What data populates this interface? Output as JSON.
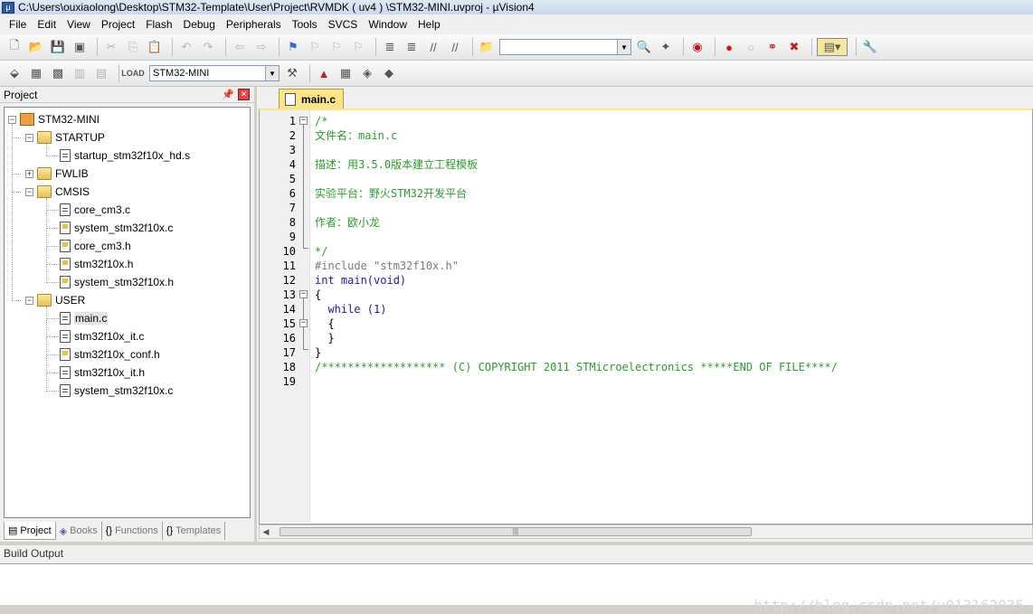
{
  "window": {
    "title": "C:\\Users\\ouxiaolong\\Desktop\\STM32-Template\\User\\Project\\RVMDK ( uv4 ) \\STM32-MINI.uvproj - µVision4"
  },
  "menu": [
    "File",
    "Edit",
    "View",
    "Project",
    "Flash",
    "Debug",
    "Peripherals",
    "Tools",
    "SVCS",
    "Window",
    "Help"
  ],
  "toolbar": {
    "search_combo_value": "",
    "target_combo_value": "STM32-MINI"
  },
  "project_panel": {
    "title": "Project",
    "tree": {
      "root": "STM32-MINI",
      "groups": [
        {
          "name": "STARTUP",
          "files": [
            "startup_stm32f10x_hd.s"
          ]
        },
        {
          "name": "FWLIB",
          "files": []
        },
        {
          "name": "CMSIS",
          "files": [
            "core_cm3.c",
            "system_stm32f10x.c",
            "core_cm3.h",
            "stm32f10x.h",
            "system_stm32f10x.h"
          ]
        },
        {
          "name": "USER",
          "files": [
            "main.c",
            "stm32f10x_it.c",
            "stm32f10x_conf.h",
            "stm32f10x_it.h",
            "system_stm32f10x.c"
          ]
        }
      ]
    },
    "tabs": [
      "Project",
      "Books",
      "Functions",
      "Templates"
    ]
  },
  "editor": {
    "tab_label": "main.c",
    "lines": [
      {
        "n": "1",
        "text": "/*"
      },
      {
        "n": "2",
        "text": "文件名：main.c"
      },
      {
        "n": "3",
        "text": ""
      },
      {
        "n": "4",
        "text": "描述：用3.5.0版本建立工程模板"
      },
      {
        "n": "5",
        "text": ""
      },
      {
        "n": "6",
        "text": "实验平台：野火STM32开发平台"
      },
      {
        "n": "7",
        "text": ""
      },
      {
        "n": "8",
        "text": "作者：欧小龙"
      },
      {
        "n": "9",
        "text": ""
      },
      {
        "n": "10",
        "text": "*/"
      },
      {
        "n": "11",
        "text": "#include \"stm32f10x.h\""
      },
      {
        "n": "12",
        "text": "int main(void)"
      },
      {
        "n": "13",
        "text": "{"
      },
      {
        "n": "14",
        "text": "  while (1)"
      },
      {
        "n": "15",
        "text": "  {"
      },
      {
        "n": "16",
        "text": "  }"
      },
      {
        "n": "17",
        "text": "}"
      },
      {
        "n": "18",
        "text": "/******************* (C) COPYRIGHT 2011 STMicroelectronics *****END OF FILE****/"
      },
      {
        "n": "19",
        "text": ""
      }
    ]
  },
  "build_output": {
    "title": "Build Output",
    "watermark": "http://blog.csdn.net/u013162035"
  }
}
